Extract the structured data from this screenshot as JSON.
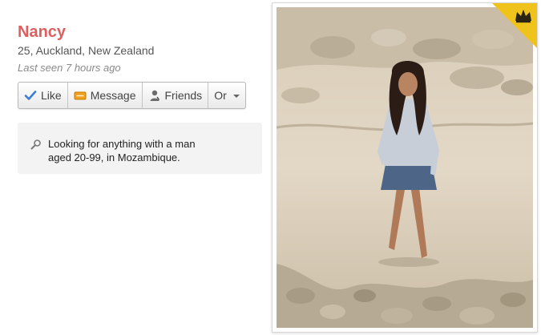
{
  "profile": {
    "name": "Nancy",
    "age_location": "25, Auckland, New Zealand",
    "last_seen": "Last seen 7 hours ago"
  },
  "actions": {
    "like": "Like",
    "message": "Message",
    "friends": "Friends",
    "or": "Or"
  },
  "looking_for": {
    "line1": "Looking for anything with a man",
    "line2": "aged 20-99, in Mozambique."
  },
  "photo": {
    "badge": "crown-icon",
    "accent": "#f0c31c"
  },
  "colors": {
    "name": "#e05d5d",
    "like_check": "#3b7dd8",
    "message_icon": "#f0a020"
  }
}
